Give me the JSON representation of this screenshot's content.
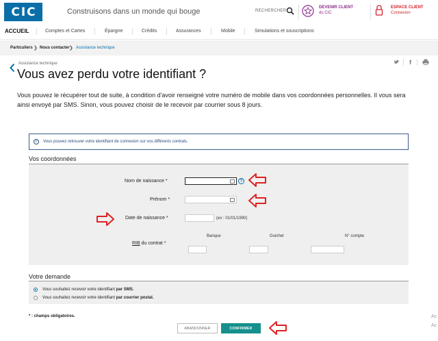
{
  "header": {
    "logo": [
      "C",
      "I",
      "C"
    ],
    "tagline": "Construisons dans un monde qui bouge",
    "search_label": "RECHERCHER",
    "become_client_line1": "DEVENIR CLIENT",
    "become_client_line2": "du CIC",
    "client_space_line1": "ESPACE CLIENT",
    "client_space_line2": "Connexion"
  },
  "nav": {
    "home": "ACCUEIL",
    "items": [
      "Comptes et Cartes",
      "Épargne",
      "Crédits",
      "Assurances",
      "Mobile",
      "Simulations et souscriptions"
    ]
  },
  "breadcrumb": [
    "Particuliers",
    "Nous contacter",
    "Assistance technique"
  ],
  "page": {
    "section_tag": "Assistance technique",
    "title": "Vous avez perdu votre identifiant ?",
    "intro": "Vous pouvez le récupérer tout de suite, à condition d'avoir renseigné votre numéro de mobile dans vos coordonnées personnelles. Il vous sera ainsi envoyé par SMS. Sinon, vous pouvez choisir de le recevoir par courrier sous 8 jours.",
    "info": "Vous pouvez retrouver votre identifiant de connexion sur vos différents contrats."
  },
  "form": {
    "section_title": "Vos coordonnées",
    "birth_name_label": "Nom de naissance *",
    "first_name_label": "Prénom *",
    "birth_date_label": "Date de naissance *",
    "birth_date_hint": "(ex : 01/01/1990)",
    "rib_label_prefix": "RIB",
    "rib_label_suffix": " du contrat *",
    "rib_columns": [
      "Banque",
      "Guichet",
      "N° compte"
    ],
    "birth_name_value": "",
    "first_name_value": "",
    "birth_date_value": ""
  },
  "demande": {
    "section_title": "Votre demande",
    "option_sms_prefix": "Vous souhaitez recevoir votre identifiant ",
    "option_sms_bold": "par SMS.",
    "option_mail_prefix": "Vous souhaitez recevoir votre identifiant ",
    "option_mail_bold": "par courrier postal.",
    "selected": "sms"
  },
  "footer": {
    "required_note": "* : champs obligatoires.",
    "cancel": "ABANDONNER",
    "confirm": "CONFIRMER"
  },
  "edge_fragments": [
    "Ac",
    "Ac"
  ],
  "colors": {
    "brand_blue": "#0a6fa8",
    "confirm_teal": "#16908c",
    "annotation_red": "#e02020",
    "client_purple": "#8b2a8b",
    "client_red": "#d2232a"
  }
}
